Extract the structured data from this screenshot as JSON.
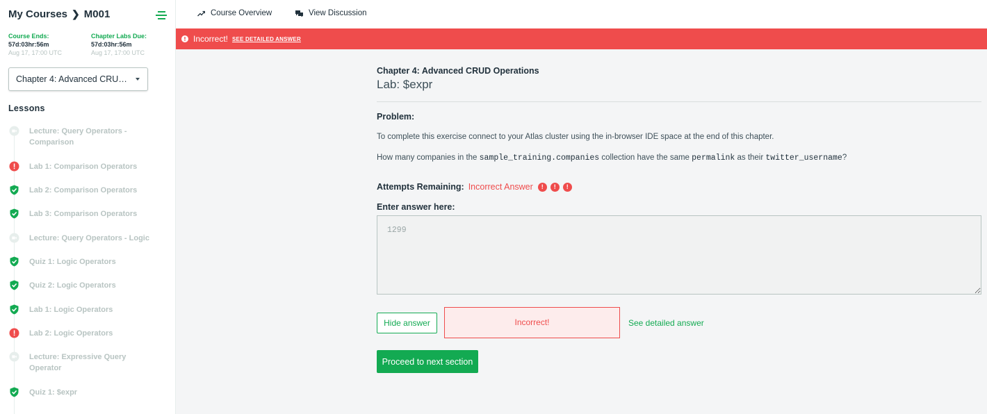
{
  "sidebar": {
    "breadcrumb_root": "My Courses",
    "breadcrumb_course": "M001",
    "course_ends_label": "Course Ends:",
    "course_ends_countdown": "57d:03hr:56m",
    "course_ends_date": "Aug 17, 17:00 UTC",
    "labs_due_label": "Chapter Labs Due:",
    "labs_due_countdown": "57d:03hr:56m",
    "labs_due_date": "Aug 17, 17:00 UTC",
    "chapter_select_value": "Chapter 4: Advanced CRUD Operations",
    "lessons_title": "Lessons",
    "lessons": [
      {
        "label": "Lecture: Query Operators - Comparison",
        "status": "video"
      },
      {
        "label": "Lab 1: Comparison Operators",
        "status": "incorrect"
      },
      {
        "label": "Lab 2: Comparison Operators",
        "status": "correct"
      },
      {
        "label": "Lab 3: Comparison Operators",
        "status": "correct"
      },
      {
        "label": "Lecture: Query Operators - Logic",
        "status": "video"
      },
      {
        "label": "Quiz 1: Logic Operators",
        "status": "correct"
      },
      {
        "label": "Quiz 2: Logic Operators",
        "status": "correct"
      },
      {
        "label": "Lab 1: Logic Operators",
        "status": "correct"
      },
      {
        "label": "Lab 2: Logic Operators",
        "status": "incorrect"
      },
      {
        "label": "Lecture: Expressive Query Operator",
        "status": "video"
      },
      {
        "label": "Quiz 1: $expr",
        "status": "correct"
      }
    ]
  },
  "topnav": {
    "course_overview": "Course Overview",
    "view_discussion": "View Discussion"
  },
  "alert": {
    "message": "Incorrect!",
    "link": "SEE DETAILED ANSWER"
  },
  "main": {
    "chapter": "Chapter 4: Advanced CRUD Operations",
    "lab_title": "Lab: $expr",
    "problem_label": "Problem:",
    "para1": "To complete this exercise connect to your Atlas cluster using the in-browser IDE space at the end of this chapter.",
    "para2_a": "How many companies in the ",
    "para2_code1": "sample_training.companies",
    "para2_b": " collection have the same ",
    "para2_code2": "permalink",
    "para2_c": " as their ",
    "para2_code3": "twitter_username",
    "para2_d": "?",
    "attempts_label": "Attempts Remaining:",
    "attempts_status": "Incorrect Answer",
    "enter_label": "Enter answer here:",
    "answer_value": "1299",
    "hide_answer": "Hide answer",
    "incorrect_feedback": "Incorrect!",
    "see_detailed": "See detailed answer",
    "proceed": "Proceed to next section"
  },
  "colors": {
    "accent": "#13aa52",
    "error": "#ef4c4c"
  }
}
